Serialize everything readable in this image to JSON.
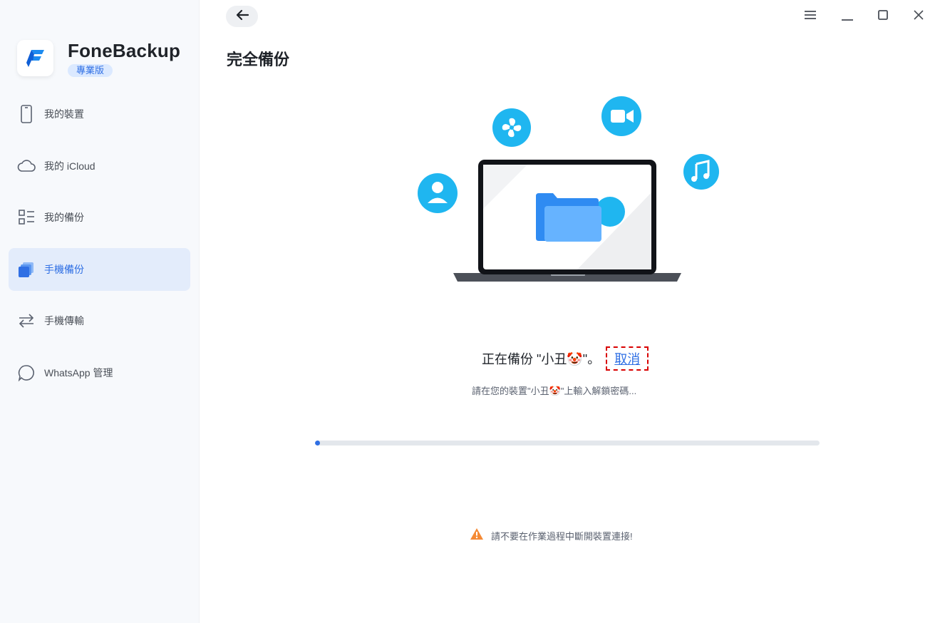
{
  "app": {
    "name": "FoneBackup",
    "edition": "專業版"
  },
  "sidebar": {
    "items": [
      {
        "label": "我的裝置",
        "icon": "phone-icon",
        "active": false
      },
      {
        "label": "我的 iCloud",
        "icon": "cloud-icon",
        "active": false
      },
      {
        "label": "我的備份",
        "icon": "list-icon",
        "active": false
      },
      {
        "label": "手機備份",
        "icon": "backup-icon",
        "active": true
      },
      {
        "label": "手機傳輸",
        "icon": "transfer-icon",
        "active": false
      },
      {
        "label": "WhatsApp 管理",
        "icon": "chat-bubble-icon",
        "active": false
      }
    ]
  },
  "header": {
    "title": "完全備份"
  },
  "status": {
    "text": "正在備份 \"小丑🤡\"。",
    "cancel_label": "取消",
    "hint": "請在您的裝置\"小丑🤡\"上輸入解鎖密碼...",
    "progress": 0.01
  },
  "warning": {
    "text": "請不要在作業過程中斷開裝置連接!"
  },
  "colors": {
    "accent": "#2f6fe4",
    "icon_cyan": "#1fb6f0",
    "sidebar_bg": "#f7f9fc",
    "active_bg": "#e3ecfb",
    "warning": "#f58a35"
  }
}
